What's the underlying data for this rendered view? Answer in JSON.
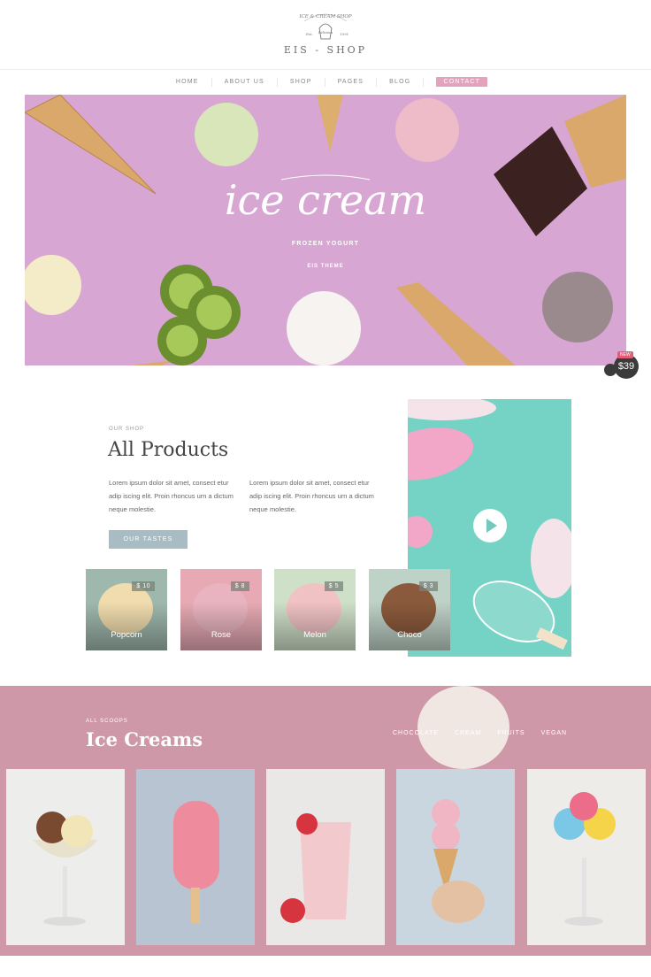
{
  "header": {
    "emblem_text_top": "ICE & CREAM SHOP",
    "emblem_est": "Est.",
    "emblem_year": "1991",
    "emblem_label": "Delicious",
    "site_name": "EIS - SHOP"
  },
  "nav": {
    "items": [
      "HOME",
      "ABOUT US",
      "SHOP",
      "PAGES",
      "BLOG"
    ],
    "contact": "CONTACT"
  },
  "hero": {
    "title": "ice cream",
    "subtitle": "FROZEN YOGURT",
    "theme": "EIS THEME",
    "bg_color": "#d8a6d3"
  },
  "badge": {
    "new": "NEW",
    "count": "$39"
  },
  "shop": {
    "eyebrow": "OUR SHOP",
    "title": "All Products",
    "text1": "Lorem ipsum dolor sit amet, consect etur adip iscing elit. Proin rhoncus urn a dictum neque molestie.",
    "text2": "Lorem ipsum dolor sit amet, consect etur adip iscing elit. Proin rhoncus urn a dictum neque molestie.",
    "button": "OUR TASTES",
    "video_color": "#74d3c4"
  },
  "products": [
    {
      "name": "Popcorn",
      "price": "$ 10",
      "bg": "#9fb8ad",
      "scoop": "#f1dcae"
    },
    {
      "name": "Rose",
      "price": "$ 8",
      "bg": "#e7aab4",
      "scoop": "#e9b4bf"
    },
    {
      "name": "Melon",
      "price": "$ 5",
      "bg": "#cfe0c9",
      "scoop": "#f0c2c4"
    },
    {
      "name": "Choco",
      "price": "$ 3",
      "bg": "#bfd2c8",
      "scoop": "#8b5a3c"
    }
  ],
  "scoops": {
    "eyebrow": "ALL SCOOPS",
    "title": "Ice Creams",
    "filters": [
      "CHOCOLATE",
      "CREAM",
      "FRUITS",
      "VEGAN"
    ],
    "bg_color": "#cf98a9"
  },
  "cards": [
    {
      "bg": "#ededeb",
      "icon": "sundae-icon"
    },
    {
      "bg": "#b9c4d2",
      "icon": "popsicle-icon"
    },
    {
      "bg": "#e9e8e6",
      "icon": "milkshake-icon"
    },
    {
      "bg": "#c9d6df",
      "icon": "cone-icon"
    },
    {
      "bg": "#eeece9",
      "icon": "sundae-icon"
    }
  ]
}
